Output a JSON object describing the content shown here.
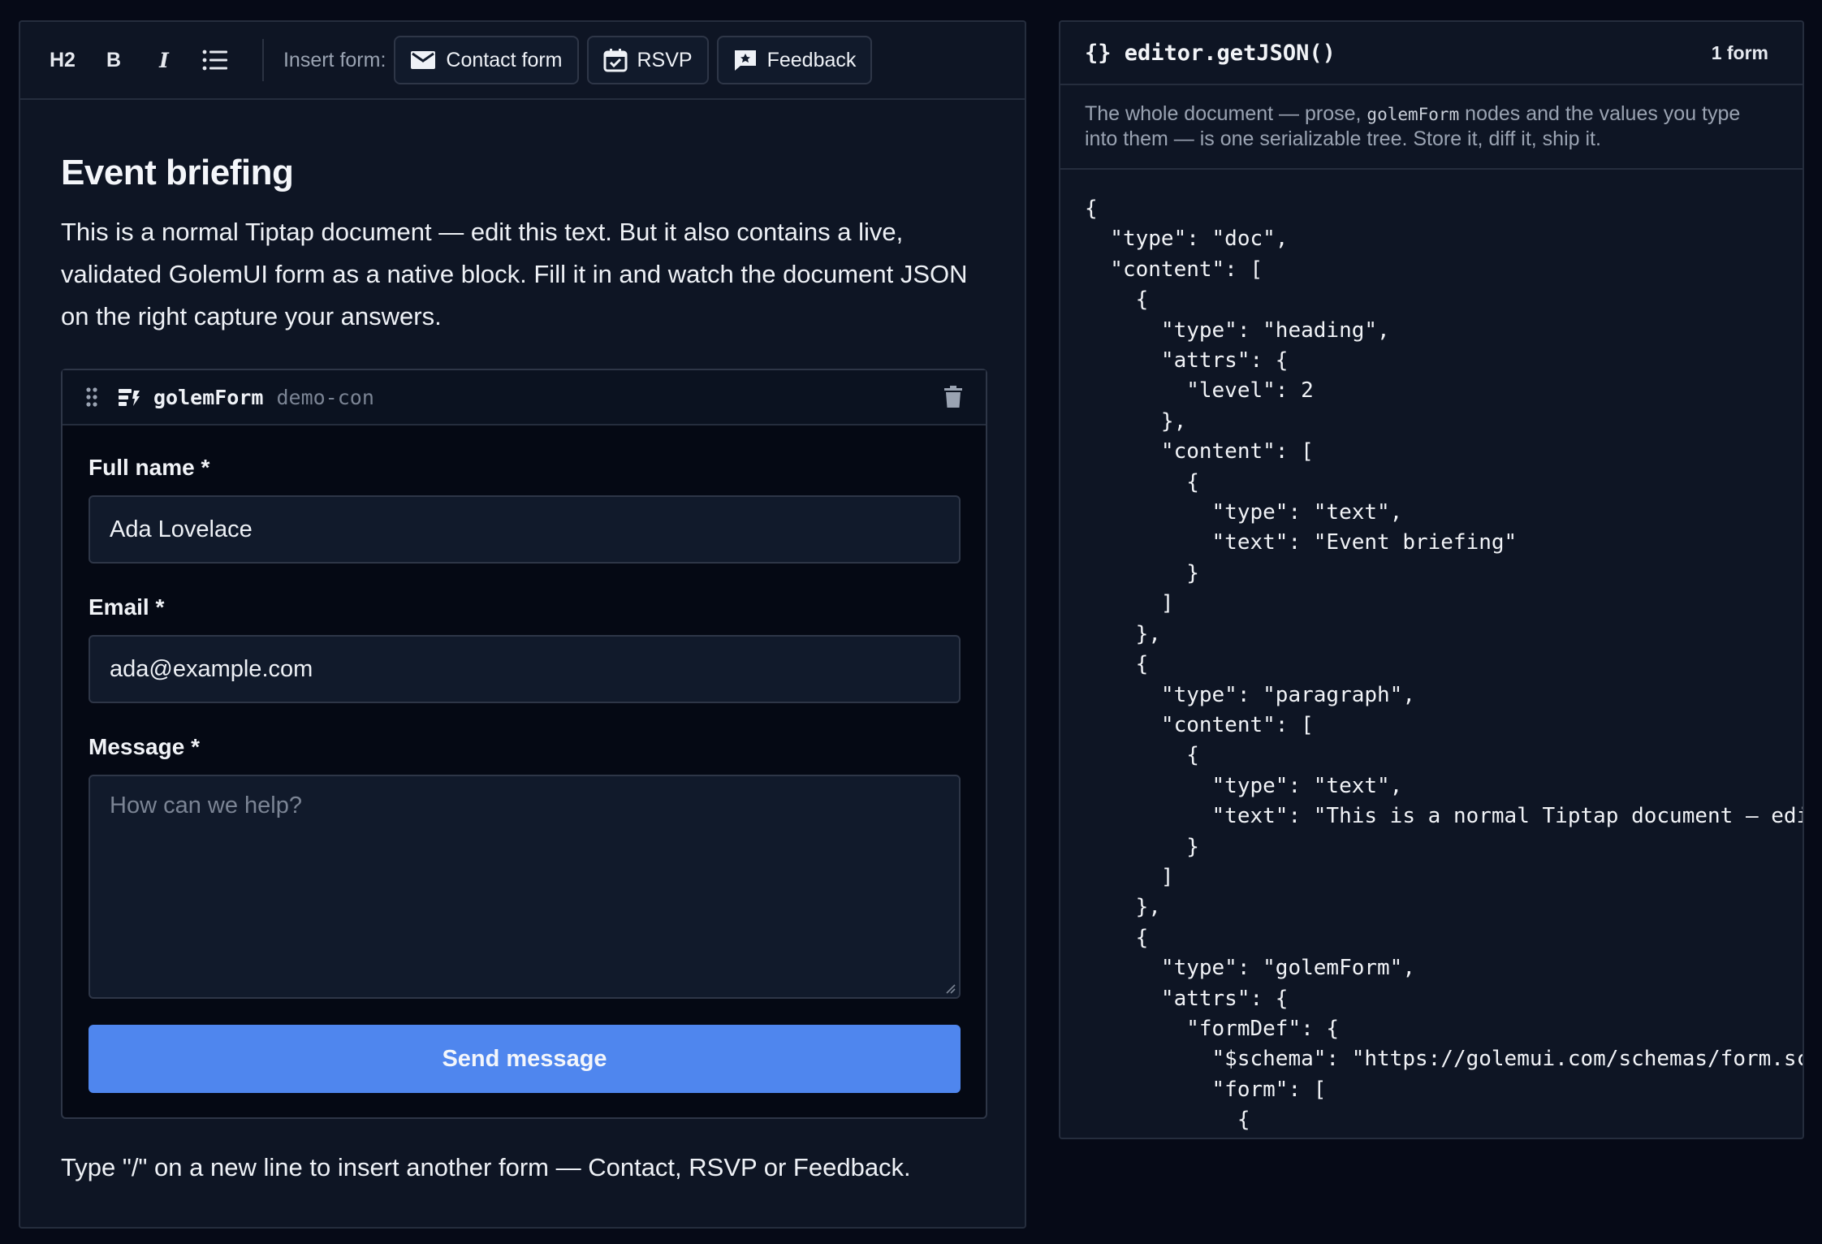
{
  "toolbar": {
    "h2_label": "H2",
    "bold_label": "B",
    "italic_label": "I",
    "insert_label": "Insert form:",
    "forms": [
      {
        "label": "Contact form",
        "icon": "mail-icon"
      },
      {
        "label": "RSVP",
        "icon": "calendar-check-icon"
      },
      {
        "label": "Feedback",
        "icon": "feedback-icon"
      }
    ]
  },
  "document": {
    "title": "Event briefing",
    "paragraph": "This is a normal Tiptap document — edit this text. But it also contains a live, validated GolemUI form as a native block. Fill it in and watch the document JSON on the right capture your answers.",
    "footer": "Type \"/\" on a new line to insert another form — Contact, RSVP or Feedback."
  },
  "form_block": {
    "node_name": "golemForm",
    "node_id": "demo-con",
    "fields": {
      "name_label": "Full name *",
      "name_value": "Ada Lovelace",
      "email_label": "Email *",
      "email_value": "ada@example.com",
      "message_label": "Message *",
      "message_placeholder": "How can we help?"
    },
    "submit_label": "Send message"
  },
  "json_panel": {
    "title": "{} editor.getJSON()",
    "count": "1 form",
    "desc_before": "The whole document — prose,",
    "desc_code": "golemForm",
    "desc_after": "nodes and the values you type into them — is one serializable tree. Store it, diff it, ship it.",
    "code": "{\n  \"type\": \"doc\",\n  \"content\": [\n    {\n      \"type\": \"heading\",\n      \"attrs\": {\n        \"level\": 2\n      },\n      \"content\": [\n        {\n          \"type\": \"text\",\n          \"text\": \"Event briefing\"\n        }\n      ]\n    },\n    {\n      \"type\": \"paragraph\",\n      \"content\": [\n        {\n          \"type\": \"text\",\n          \"text\": \"This is a normal Tiptap document — edit\n        }\n      ]\n    },\n    {\n      \"type\": \"golemForm\",\n      \"attrs\": {\n        \"formDef\": {\n          \"$schema\": \"https://golemui.com/schemas/form.sche\n          \"form\": [\n            {"
  },
  "colors": {
    "background": "#060a17",
    "panel": "#0e1524",
    "accent": "#4f86ee"
  }
}
